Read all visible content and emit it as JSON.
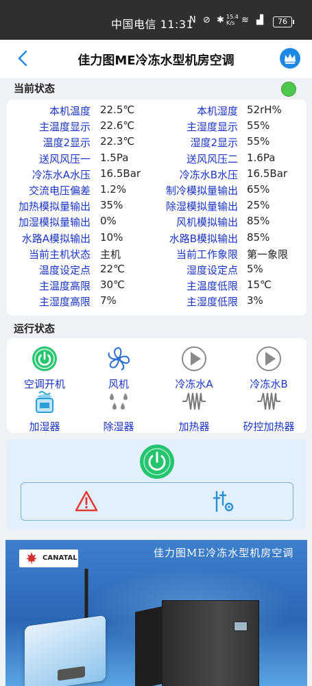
{
  "status_bar": {
    "carrier_time": "中国电信 11:31",
    "speed": "15.4 K/s",
    "battery": "76"
  },
  "header": {
    "title": "佳力图ME冷冻水型机房空调"
  },
  "current_status": {
    "section_title": "当前状态",
    "rows": [
      {
        "l1": "本机温度",
        "v1": "22.5℃",
        "l2": "本机湿度",
        "v2": "52rH%"
      },
      {
        "l1": "主温度显示",
        "v1": "22.6℃",
        "l2": "主湿度显示",
        "v2": "55%"
      },
      {
        "l1": "温度2显示",
        "v1": "22.3℃",
        "l2": "湿度2显示",
        "v2": "55%"
      },
      {
        "l1": "送风风压一",
        "v1": "1.5Pa",
        "l2": "送风风压二",
        "v2": "1.6Pa"
      },
      {
        "l1": "冷冻水A水压",
        "v1": "16.5Bar",
        "l2": "冷冻水B水压",
        "v2": "16.5Bar"
      },
      {
        "l1": "交流电压偏差",
        "v1": "1.2%",
        "l2": "制冷模拟量输出",
        "v2": "65%"
      },
      {
        "l1": "加热模拟量输出",
        "v1": "35%",
        "l2": "除湿模拟量输出",
        "v2": "25%"
      },
      {
        "l1": "加湿模拟量输出",
        "v1": "0%",
        "l2": "风机模拟输出",
        "v2": "85%"
      },
      {
        "l1": "水路A模拟输出",
        "v1": "10%",
        "l2": "水路B模拟输出",
        "v2": "85%"
      },
      {
        "l1": "当前主机状态",
        "v1": "主机",
        "l2": "当前工作象限",
        "v2": "第一象限"
      },
      {
        "l1": "温度设定点",
        "v1": "22℃",
        "l2": "湿度设定点",
        "v2": "5%"
      },
      {
        "l1": "主温度高限",
        "v1": "30℃",
        "l2": "主温度低限",
        "v2": "15℃"
      },
      {
        "l1": "主湿度高限",
        "v1": "7%",
        "l2": "主湿度低限",
        "v2": "3%"
      }
    ]
  },
  "run_status": {
    "section_title": "运行状态",
    "items": [
      {
        "label": "空调开机",
        "icon": "power-on-icon"
      },
      {
        "label": "风机",
        "icon": "fan-icon"
      },
      {
        "label": "冷冻水A",
        "icon": "play-icon"
      },
      {
        "label": "冷冻水B",
        "icon": "play-icon"
      },
      {
        "label": "加湿器",
        "icon": "humidifier-icon"
      },
      {
        "label": "除湿器",
        "icon": "dehumidifier-icon"
      },
      {
        "label": "加热器",
        "icon": "heater-icon"
      },
      {
        "label": "矽控加热器",
        "icon": "heater-icon"
      }
    ]
  },
  "banner": {
    "title": "佳力图ME冷冻水型机房空调",
    "logo_text": "CANATAL"
  },
  "colors": {
    "accent_blue": "#1a33c8",
    "status_green": "#4cc94c",
    "power_green": "#25c46f",
    "alarm_red": "#e53935"
  }
}
